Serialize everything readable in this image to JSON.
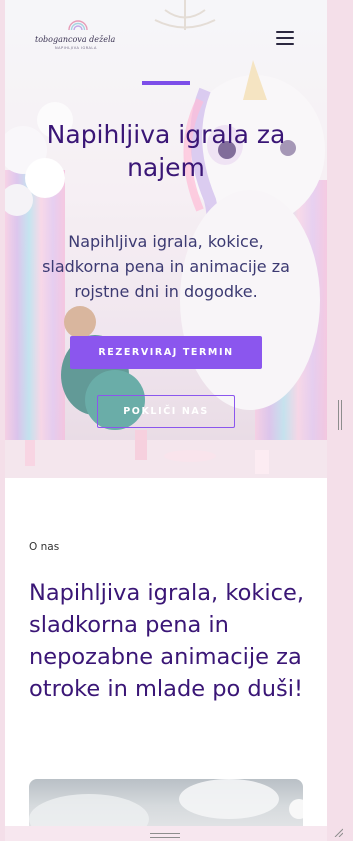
{
  "header": {
    "logo_text": "tobogancova dežela",
    "logo_sub": "NAPIHLJIVA IGRALA",
    "menu_icon": "hamburger-menu-icon"
  },
  "hero": {
    "title": "Napihljiva igrala za najem",
    "subtitle": "Napihljiva igrala, kokice, sladkorna pena in animacije za rojstne dni in dogodke.",
    "primary_button": "REZERVIRAJ TERMIN",
    "secondary_button": "POKLIČI NAS"
  },
  "about": {
    "label": "O nas",
    "title": "Napihljiva igrala, kokice, sladkorna pena in nepozabne animacije za otroke in mlade po duši!"
  },
  "colors": {
    "accent": "#8b56ee",
    "heading": "#3a1676",
    "subtitle": "#3c3a72"
  }
}
